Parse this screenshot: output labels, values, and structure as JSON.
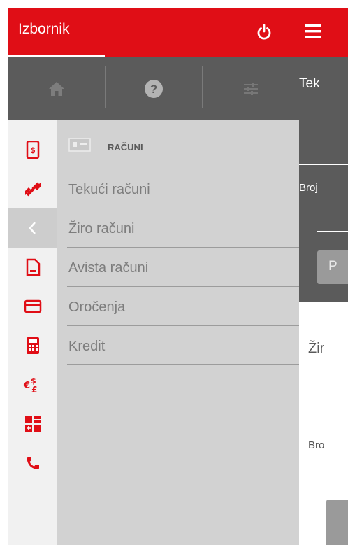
{
  "drawer": {
    "title": "Izbornik",
    "icons": {
      "power": "power-icon"
    },
    "toolbar": {
      "buttons": [
        {
          "name": "home-button",
          "icon": "home-icon"
        },
        {
          "name": "help-button",
          "icon": "help-icon"
        },
        {
          "name": "settings-button",
          "icon": "sliders-icon"
        }
      ]
    },
    "rail": [
      {
        "icon": "mobile-banking-icon"
      },
      {
        "icon": "transfer-arrows-icon"
      },
      {
        "icon": "chevron-left-icon",
        "active": true
      },
      {
        "icon": "document-icon"
      },
      {
        "icon": "card-icon"
      },
      {
        "icon": "calculator-icon"
      },
      {
        "icon": "currency-exchange-icon"
      },
      {
        "icon": "widgets-icon"
      },
      {
        "icon": "phone-icon"
      }
    ],
    "menu": {
      "header": "RAČUNI",
      "header_icon": "accounts-icon",
      "items": [
        "Tekući računi",
        "Žiro računi",
        "Avista računi",
        "Oročenja",
        "Kredit"
      ]
    }
  },
  "page": {
    "text_1": "Tek",
    "text_2": "Broj",
    "button_1": "P",
    "text_3": "Žir",
    "text_4": "Bro"
  },
  "colors": {
    "brand_red": "#e00e16",
    "dark_gray": "#5b5b5b",
    "panel_gray": "#d2d2d2",
    "rail_gray": "#f1f1f1"
  }
}
